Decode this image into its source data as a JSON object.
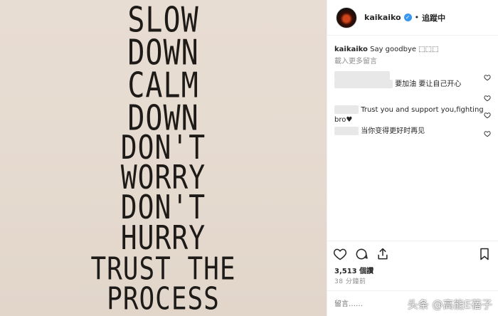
{
  "post_image": {
    "lines": [
      "SLOW",
      "DOWN",
      "CALM",
      "DOWN",
      "DON'T",
      "WORRY",
      "DON'T",
      "HURRY",
      "TRUST THE",
      "PROCESS"
    ]
  },
  "header": {
    "username": "kaikaiko",
    "dot": "•",
    "follow_status": "追蹤中",
    "verified_icon": "verified-badge-icon"
  },
  "caption": {
    "username": "kaikaiko",
    "text": "Say goodbye ⬚⬚⬚"
  },
  "load_more": "載入更多留言",
  "comments": [
    {
      "text": "要加油 要让自己开心"
    },
    {
      "text": "Trust you and support you,fighting bro♥"
    },
    {
      "text": "当你变得更好时再见"
    }
  ],
  "likes": "3,513 個讚",
  "timestamp": "38 分鐘前",
  "comment_box": {
    "placeholder": "留言……"
  },
  "watermark": "头条 @高能E蓓子",
  "colors": {
    "link_blue": "#3897f0",
    "muted": "#8e8e8e",
    "poster_bg": "#e6dbd0",
    "poster_ink": "#1d1a17"
  }
}
